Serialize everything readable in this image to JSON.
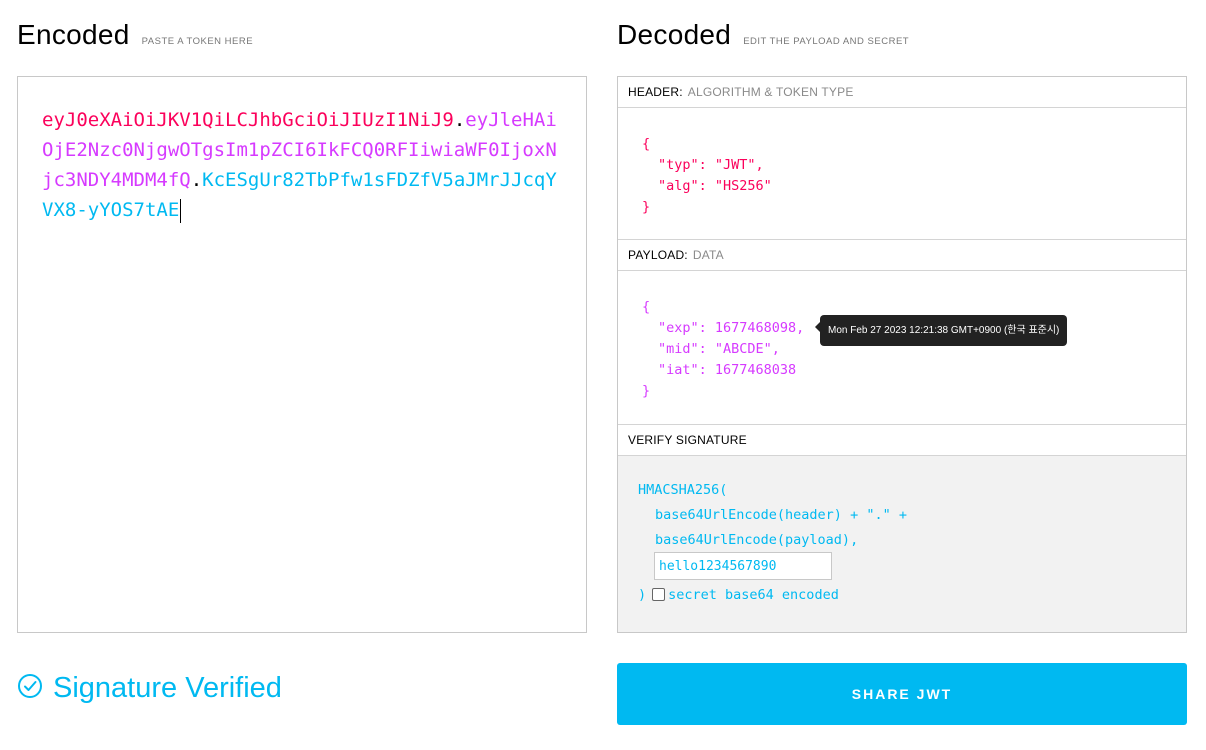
{
  "encoded": {
    "title": "Encoded",
    "subtitle": "PASTE A TOKEN HERE",
    "token_header": "eyJ0eXAiOiJKV1QiLCJhbGciOiJIUzI1NiJ9",
    "token_payload": "eyJleHAiOjE2Nzc0NjgwOTgsIm1pZCI6IkFCQ0RFIiwiaWF0IjoxNjc3NDY4MDM4fQ",
    "token_signature": "KcESgUr82TbPfw1sFDZfV5aJMrJJcqYVX8-yYOS7tAE",
    "dot": "."
  },
  "decoded": {
    "title": "Decoded",
    "subtitle": "EDIT THE PAYLOAD AND SECRET",
    "header_panel": {
      "label": "HEADER:",
      "sublabel": "ALGORITHM & TOKEN TYPE",
      "lines": [
        "{",
        "\"typ\": \"JWT\",",
        "\"alg\": \"HS256\"",
        "}"
      ]
    },
    "payload_panel": {
      "label": "PAYLOAD:",
      "sublabel": "DATA",
      "lines": [
        "{",
        "\"exp\": 1677468098,",
        "\"mid\": \"ABCDE\",",
        "\"iat\": 1677468038",
        "}"
      ],
      "tooltip": "Mon Feb 27 2023 12:21:38 GMT+0900 (한국 표준시)"
    },
    "verify_panel": {
      "label": "VERIFY SIGNATURE",
      "line1": "HMACSHA256(",
      "line2": "base64UrlEncode(header) + \".\" +",
      "line3": "base64UrlEncode(payload),",
      "secret_value": "hello1234567890",
      "close_paren": ")",
      "checkbox_label": "secret base64 encoded"
    }
  },
  "status": {
    "text": "Signature Verified",
    "icon": "check-circle-icon"
  },
  "share_button": "SHARE JWT",
  "colors": {
    "header": "#fb015b",
    "payload": "#d63aff",
    "signature": "#00b9f1"
  }
}
